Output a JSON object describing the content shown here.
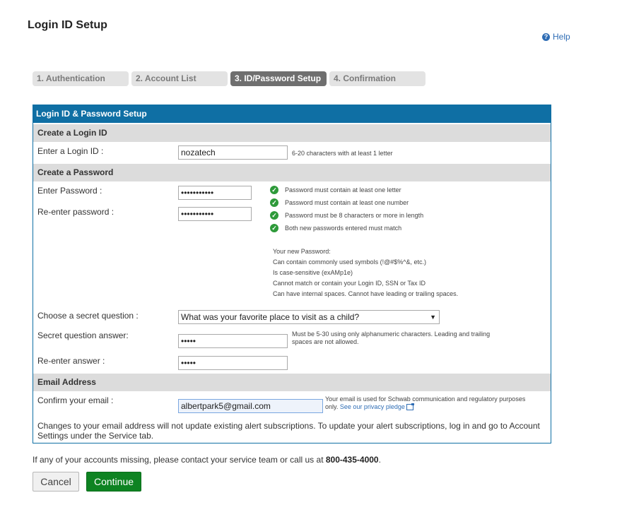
{
  "page": {
    "title": "Login ID Setup",
    "help_label": "Help",
    "help_icon": "question-circle-icon"
  },
  "steps": [
    {
      "label": "1. Authentication",
      "active": false
    },
    {
      "label": "2. Account List",
      "active": false
    },
    {
      "label": "3. ID/Password Setup",
      "active": true
    },
    {
      "label": "4. Confirmation",
      "active": false
    }
  ],
  "panel": {
    "header": "Login ID & Password Setup",
    "login_section": {
      "title": "Create a Login ID",
      "login_label": "Enter a Login ID :",
      "login_value": "nozatech",
      "login_hint": "6-20 characters with at least 1 letter"
    },
    "password_section": {
      "title": "Create a Password",
      "password_label": "Enter Password :",
      "password_value": "•••••••••••",
      "reenter_label": "Re-enter password :",
      "reenter_value": "•••••••••••",
      "rules": [
        "Password must contain at least one letter",
        "Password must contain at least one number",
        "Password must be 8 characters or more in length",
        "Both new passwords entered must match"
      ],
      "rule_icon": "check-circle-icon",
      "info": [
        "Your new Password:",
        "Can contain commonly used symbols (!@#$%^&, etc.)",
        "Is case-sensitive (exAMp1e)",
        "Cannot match or contain your Login ID, SSN or Tax ID",
        "Can have internal spaces. Cannot have leading or trailing spaces."
      ],
      "question_label": "Choose a secret question :",
      "question_value": "What was your favorite place to visit as a child?",
      "answer_label": "Secret question answer:",
      "answer_value": "•••••",
      "answer_hint": "Must be 5-30 using only alphanumeric characters. Leading and trailing spaces are not allowed.",
      "reanswer_label": "Re-enter answer :",
      "reanswer_value": "•••••"
    },
    "email_section": {
      "title": "Email Address",
      "email_label": "Confirm your email :",
      "email_value": "albertpark5@gmail.com",
      "email_hint": "Your email is used for Schwab communication and regulatory purposes only.",
      "privacy_link": "See our privacy pledge",
      "note": "Changes to your email address will not update existing alert subscriptions. To update your alert subscriptions, log in and go to Account Settings under the Service tab."
    }
  },
  "footer": {
    "text": "If any of your accounts missing, please contact your service team or call us at ",
    "phone": "800-435-4000",
    "period": ".",
    "cancel_label": "Cancel",
    "continue_label": "Continue"
  },
  "colors": {
    "panel_header": "#0f6fa4",
    "section_bg": "#dcdcdc",
    "active_step": "#6f6f6f",
    "continue": "#0e8322",
    "check": "#2e9a3a",
    "link": "#2f6db5"
  }
}
